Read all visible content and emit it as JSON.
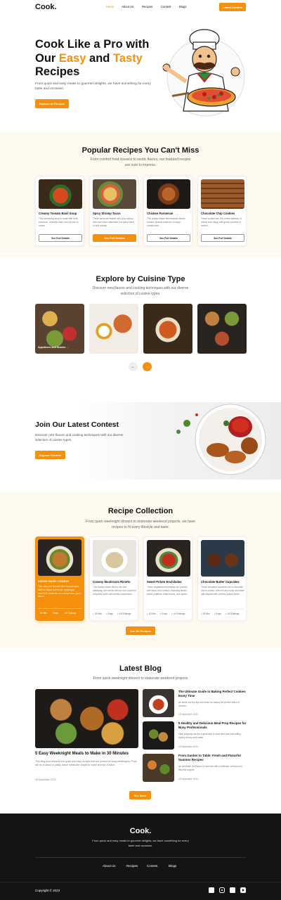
{
  "nav": {
    "logo": "Cook.",
    "links": [
      "Home",
      "About Us",
      "Recipes",
      "Contest",
      "Blogs"
    ],
    "cta": "Latest Contest"
  },
  "hero": {
    "title_1": "Cook Like a Pro with",
    "title_2a": "Our ",
    "title_2b": "Easy",
    "title_2c": " and ",
    "title_2d": "Tasty",
    "title_3": "Recipes",
    "subtitle": "From quick and easy meals to gourmet delights, we have something for every taste and occasion.",
    "button": "Explore all Recipes"
  },
  "popular": {
    "title": "Popular Recipes You Can't Miss",
    "subtitle": "From comfort food classics to exotic flavors, our featured recipes are sure to impress.",
    "cards": [
      {
        "title": "Creamy Tomato Basil Soup",
        "desc": "This comforting soup is made with fresh tomatoes, aromatic basil, and a touch of cream.",
        "button": "See Full Details"
      },
      {
        "title": "Spicy Shrimp Tacos",
        "desc": "These tacos are loaded with juicy shrimp that have been marinated in a spicy blend of chili powder.",
        "button": "See Full Details"
      },
      {
        "title": "Chicken Parmesan",
        "desc": "This classic Italian dish features tender chicken breasts coated in a crispy breadcrumb...",
        "button": "See Full Details"
      },
      {
        "title": "Chocolate Chip Cookies",
        "desc": "These cookies are the perfect balance of chewy and crispy, with gooey pockets of melted...",
        "button": "See Full Details"
      }
    ]
  },
  "cuisine": {
    "title": "Explore by Cuisine Type",
    "subtitle": "Discover new flavors and cooking techniques with our diverse selection of cuisine types.",
    "first_label": "Appetizers and Snacks",
    "first_arrow": "→",
    "prev": "←",
    "next": "→"
  },
  "contest": {
    "title": "Join Our Latest Contest",
    "subtitle": "Discover new flavors and cooking techniques with our diverse selection of cuisine types.",
    "button": "Explore Contest"
  },
  "collection": {
    "title": "Recipe Collection",
    "subtitle": "From quick weeknight dinners to elaborate weekend projects, we have recipes to fit every lifestyle and taste.",
    "cards": [
      {
        "title": "Lemon Garlic Chicken",
        "desc": "This easy and flavorful dish features juicy chicken thighs and tender asparagus roasted to perfection in a zesty lemon garlic sauce.",
        "time": "30 Min",
        "level": "Easy",
        "rating": "4.9 Ratings"
      },
      {
        "title": "Creamy Mushroom Risotto",
        "desc": "This classic Italian dish is rich and satisfying, with tender arborio rice cooked in a flavorful broth with earthy mushrooms.",
        "time": "30 Min",
        "level": "Easy",
        "rating": "4.5 Ratings"
      },
      {
        "title": "Sweet Potato Enchiladas",
        "desc": "These vegetarian enchiladas are packed with flavor and nutrition, featuring tender sweet potatoes, black beans, and spices.",
        "time": "30 Min",
        "level": "Easy",
        "rating": "4.9 Ratings"
      },
      {
        "title": "Chocolate Butter Cupcakes",
        "desc": "These decadent cupcakes are a chocolate lover's dream, with rich and moist chocolate cake topped with creamy peanut butter.",
        "time": "30 Min",
        "level": "Easy",
        "rating": "4.5 Ratings"
      }
    ],
    "button": "See All Recipes"
  },
  "blog": {
    "title": "Latest Blog",
    "subtitle": "From quick weeknight dinners to elaborate weekend projects",
    "main": {
      "title": "5 Easy Weeknight Meals to Make in 30 Minutes",
      "desc": "This blog post features five quick and easy recipes that are perfect for busy weeknights. From stir-fry to tacos to pasta, these meals are simple to make and full of flavor.",
      "date": "18 September 2022"
    },
    "side": [
      {
        "title": "The Ultimate Guide to Baking Perfect Cookies Every Time",
        "desc": "we share our top tips and tricks for baking the perfect batch of cookies.",
        "date": "18 September 2022"
      },
      {
        "title": "5 Healthy and Delicious Meal Prep Recipes for Busy Professionals",
        "desc": "Meal prepping can be a great way to save time and eat healthy during a busy work week.",
        "date": "18 September 2022"
      },
      {
        "title": "From Garden to Table: Fresh and Flavorful Summer Recipes",
        "desc": "we celebrate the flavors of summer with a collection of fresh and flavorful recipes.",
        "date": "18 September 2022"
      }
    ],
    "button": "See More"
  },
  "footer": {
    "logo": "Cook.",
    "text": "From quick and easy meals to gourmet delights, we have something for every taste and occasion.",
    "links": [
      "About Us",
      "Recipes",
      "Contest",
      "Blogs"
    ],
    "copyright": "Copyright © 2023"
  },
  "colors": {
    "accent": "#f5900c",
    "cream": "#fffaf0",
    "footer": "#141414"
  }
}
